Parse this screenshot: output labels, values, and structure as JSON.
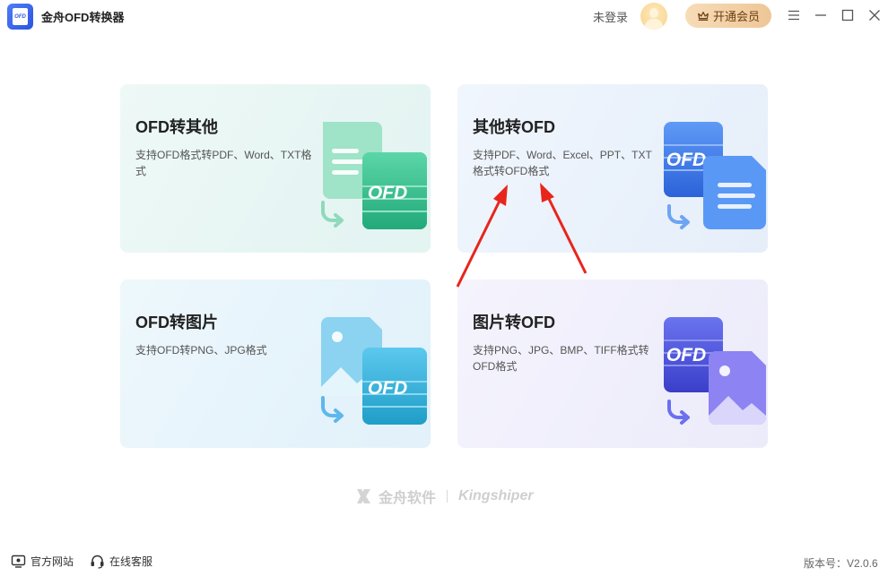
{
  "app": {
    "title": "金舟OFD转换器",
    "logo_text": "OFD"
  },
  "header": {
    "login_text": "未登录",
    "vip_button": "开通会员"
  },
  "cards": [
    {
      "title": "OFD转其他",
      "desc": "支持OFD格式转PDF、Word、TXT格式",
      "badge": "OFD",
      "icon": "ofd-to-doc-icon",
      "accent": "#2fbf8f"
    },
    {
      "title": "其他转OFD",
      "desc": "支持PDF、Word、Excel、PPT、TXT格式转OFD格式",
      "badge": "OFD",
      "icon": "doc-to-ofd-icon",
      "accent": "#3a7cf0"
    },
    {
      "title": "OFD转图片",
      "desc": "支持OFD转PNG、JPG格式",
      "badge": "OFD",
      "icon": "ofd-to-image-icon",
      "accent": "#2aa9d6"
    },
    {
      "title": "图片转OFD",
      "desc": "支持PNG、JPG、BMP、TIFF格式转OFD格式",
      "badge": "OFD",
      "icon": "image-to-ofd-icon",
      "accent": "#5a5fe8"
    }
  ],
  "brand": {
    "cn": "金舟软件",
    "en": "Kingshiper"
  },
  "footer": {
    "website": "官方网站",
    "support": "在线客服",
    "version": "版本号：V2.0.6"
  },
  "annotation": {
    "color": "#e8251c"
  }
}
